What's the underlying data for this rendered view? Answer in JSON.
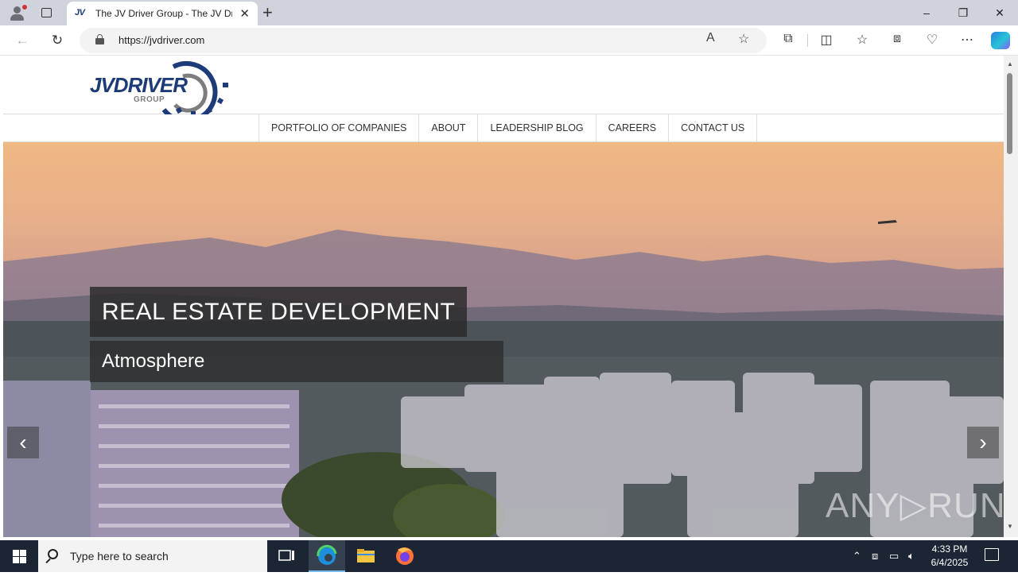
{
  "browser": {
    "tab": {
      "favicon_text": "JV",
      "title": "The JV Driver Group - The JV Driver Group"
    },
    "address": {
      "url": "https://jvdriver.com"
    },
    "window_controls": {
      "minimize": "–",
      "restore": "❐",
      "close": "✕"
    }
  },
  "site": {
    "logo": {
      "wordmark": "JVDRIVER",
      "subtitle": "GROUP"
    },
    "menu": [
      {
        "label": "PORTFOLIO OF COMPANIES"
      },
      {
        "label": "ABOUT"
      },
      {
        "label": "LEADERSHIP BLOG"
      },
      {
        "label": "CAREERS"
      },
      {
        "label": "CONTACT US"
      }
    ],
    "hero": {
      "title": "REAL ESTATE DEVELOPMENT",
      "subtitle": "Atmosphere",
      "prev": "‹",
      "next": "›"
    },
    "watermark": "ANY▷RUN"
  },
  "taskbar": {
    "search_placeholder": "Type here to search",
    "time": "4:33 PM",
    "date": "6/4/2025"
  },
  "colors": {
    "brand_blue": "#1d3b78",
    "brand_gray": "#7d7d7d",
    "caption_bg": "#282828",
    "taskbar": "#1c2533"
  }
}
